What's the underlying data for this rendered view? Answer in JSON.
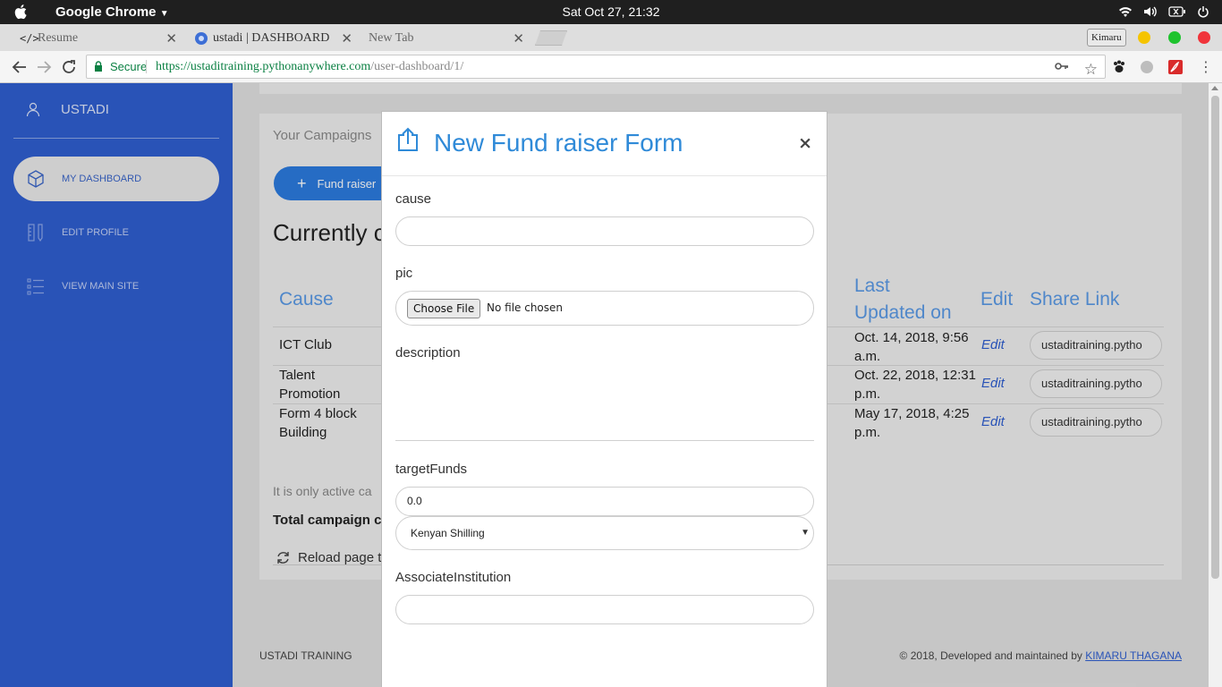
{
  "os": {
    "app_name": "Google Chrome",
    "clock": "Sat Oct 27, 21:32"
  },
  "browser": {
    "tabs": [
      {
        "label": "Resume",
        "active": false
      },
      {
        "label": "ustadi | DASHBOARD",
        "active": true
      },
      {
        "label": "New Tab",
        "active": false
      }
    ],
    "profile_name": "Kimaru",
    "secure_label": "Secure",
    "url_host": "https://ustaditraining.pythonanywhere.com",
    "url_path": "/user-dashboard/1/"
  },
  "sidebar": {
    "user": "USTADI",
    "items": [
      {
        "label": "MY DASHBOARD",
        "icon": "cube-icon",
        "active": true
      },
      {
        "label": "EDIT PROFILE",
        "icon": "ruler-pencil-icon",
        "active": false
      },
      {
        "label": "VIEW MAIN SITE",
        "icon": "list-icon",
        "active": false
      }
    ]
  },
  "dashboard": {
    "card_title": "Your Campaigns",
    "fund_button": "Fund raiser",
    "heading": "Currently c",
    "columns": {
      "cause": "Cause",
      "last_updated_line1": "Last",
      "last_updated_line2": "Updated on",
      "edit": "Edit",
      "share": "Share Link"
    },
    "rows": [
      {
        "cause_l1": "ICT Club",
        "cause_l2": "",
        "updated_l1": "Oct. 14, 2018, 9:56",
        "updated_l2": "a.m.",
        "edit": "Edit",
        "share": "ustaditraining.pytho"
      },
      {
        "cause_l1": "Talent",
        "cause_l2": "Promotion",
        "updated_l1": "Oct. 22, 2018, 12:31",
        "updated_l2": "p.m.",
        "edit": "Edit",
        "share": "ustaditraining.pytho"
      },
      {
        "cause_l1": "Form 4 block",
        "cause_l2": "Building",
        "updated_l1": "May 17, 2018, 4:25",
        "updated_l2": "p.m.",
        "edit": "Edit",
        "share": "ustaditraining.pytho"
      }
    ],
    "note": "It is only active ca",
    "total": "Total campaign c",
    "reload": "Reload page t"
  },
  "footer": {
    "left": "USTADI TRAINING",
    "right_text": "© 2018, Developed and maintained by ",
    "right_link": "KIMARU THAGANA"
  },
  "modal": {
    "title": "New Fund raiser Form",
    "close": "×",
    "fields": {
      "cause_label": "cause",
      "cause_value": "",
      "pic_label": "pic",
      "choose_file": "Choose File",
      "no_file": "No file chosen",
      "description_label": "description",
      "target_label": "targetFunds",
      "target_value": "0.0",
      "currency_selected": "Kenyan Shilling",
      "institution_label": "AssociateInstitution",
      "institution_value": ""
    }
  },
  "colors": {
    "sidebar": "#2f5fd1",
    "accent_blue": "#2f8ad8",
    "fund_button": "#2c7be0"
  }
}
